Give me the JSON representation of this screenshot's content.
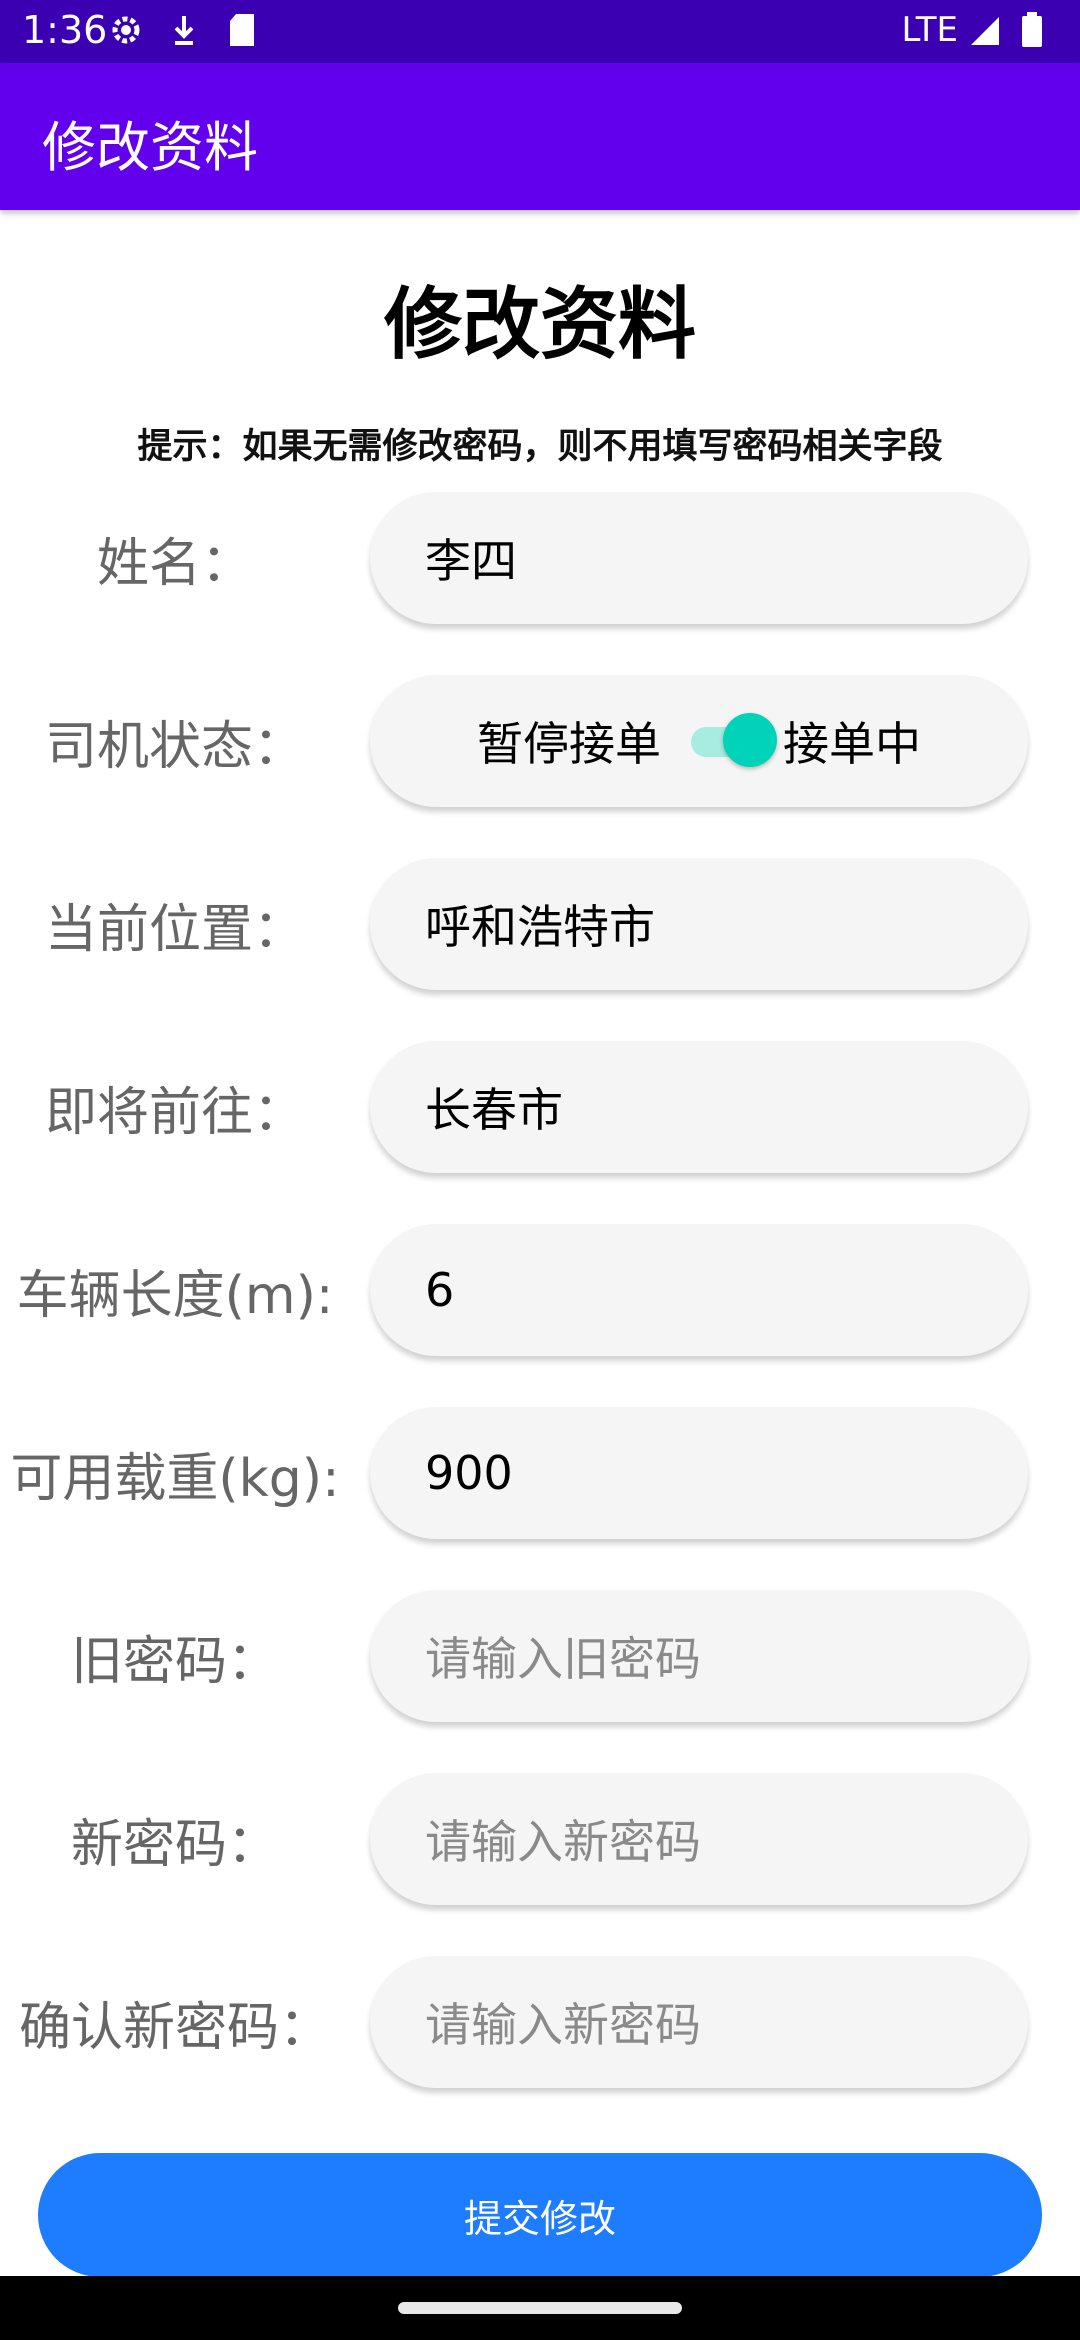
{
  "status_bar": {
    "time": "1:36",
    "network": "LTE",
    "icons": [
      "settings-gear-icon",
      "download-icon",
      "sd-card-icon",
      "signal-icon",
      "battery-icon"
    ]
  },
  "app_bar": {
    "title": "修改资料"
  },
  "page": {
    "title": "修改资料",
    "hint": "提示：如果无需修改密码，则不用填写密码相关字段"
  },
  "form": {
    "name": {
      "label": "姓名：",
      "value": "李四"
    },
    "driver_status": {
      "label": "司机状态：",
      "off_label": "暂停接单",
      "on_label": "接单中",
      "checked": true
    },
    "current_location": {
      "label": "当前位置：",
      "value": "呼和浩特市"
    },
    "destination": {
      "label": "即将前往：",
      "value": "长春市"
    },
    "vehicle_length": {
      "label": "车辆长度(m):",
      "value": "6"
    },
    "available_load": {
      "label": "可用载重(kg):",
      "value": "900"
    },
    "old_password": {
      "label": "旧密码：",
      "placeholder": "请输入旧密码"
    },
    "new_password": {
      "label": "新密码：",
      "placeholder": "请输入新密码"
    },
    "confirm_password": {
      "label": "确认新密码：",
      "placeholder": "请输入新密码"
    }
  },
  "submit_label": "提交修改",
  "colors": {
    "status_bar": "#3a00b2",
    "app_bar": "#6200ee",
    "switch_thumb": "#00d3b8",
    "switch_track": "#a8ece1",
    "submit_button": "#1e7cff",
    "field_background": "#f5f5f5"
  }
}
